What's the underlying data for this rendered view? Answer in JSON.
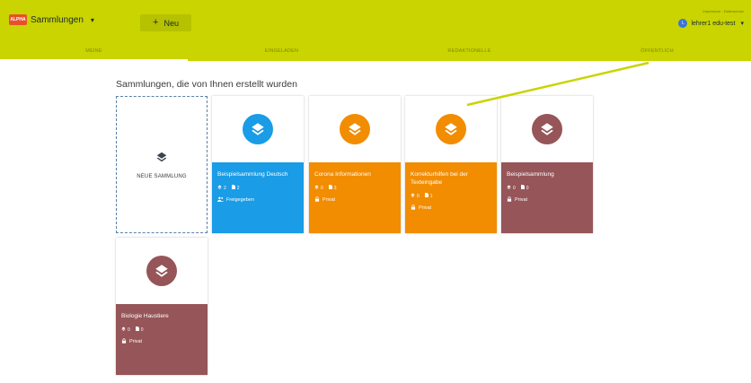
{
  "app": {
    "logo_text": "ALPHA",
    "title": "Sammlungen"
  },
  "toolbar": {
    "new_label": "Neu"
  },
  "header_links": {
    "text": "Impressum · Datenschutz"
  },
  "user": {
    "initial": "L",
    "name": "lehrer1 edu-test"
  },
  "tabs": [
    "MEINE",
    "EINGELADEN",
    "REDAKTIONELLE",
    "ÖFFENTLICH"
  ],
  "main": {
    "heading": "Sammlungen, die von Ihnen erstellt wurden",
    "new_collection_label": "NEUE SAMMLUNG"
  },
  "colors": {
    "topbar": "#c9d400",
    "blue": "#1a9ce6",
    "orange": "#f28c00",
    "maroon": "#965558",
    "annotation": "#c9d400"
  },
  "collections": [
    {
      "title": "Beispielsammlung Deutsch",
      "subcollections": "2",
      "materials": "2",
      "visibility": "Freigegeben",
      "visibility_icon": "people-icon",
      "color": "#1a9ce6"
    },
    {
      "title": "Corona Informationen",
      "subcollections": "0",
      "materials": "3",
      "visibility": "Privat",
      "visibility_icon": "lock-icon",
      "color": "#f28c00"
    },
    {
      "title": "Korrekturhilfen bei der Texteingabe",
      "subcollections": "0",
      "materials": "1",
      "visibility": "Privat",
      "visibility_icon": "lock-icon",
      "color": "#f28c00"
    },
    {
      "title": "Beispielsammlung",
      "subcollections": "0",
      "materials": "0",
      "visibility": "Privat",
      "visibility_icon": "lock-icon",
      "color": "#965558"
    },
    {
      "title": "Biologie Haustiere",
      "subcollections": "0",
      "materials": "0",
      "visibility": "Privat",
      "visibility_icon": "lock-icon",
      "color": "#965558"
    }
  ]
}
